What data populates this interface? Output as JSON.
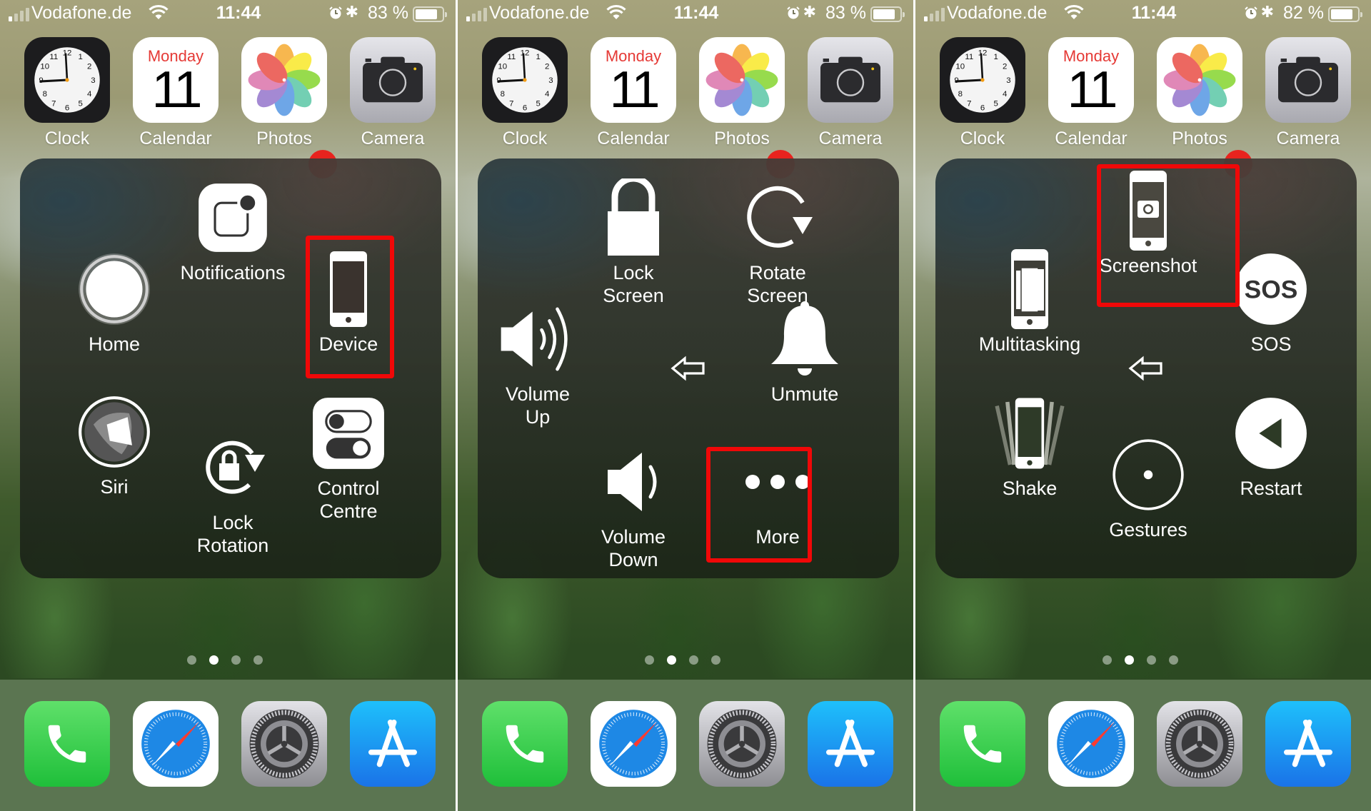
{
  "panels": [
    {
      "status": {
        "carrier": "Vodafone.de",
        "time": "11:44",
        "battery": "83 %",
        "battery_level": 0.83
      },
      "apps": [
        {
          "name": "Clock"
        },
        {
          "name": "Calendar",
          "weekday": "Monday",
          "date": "11"
        },
        {
          "name": "Photos"
        },
        {
          "name": "Camera"
        }
      ],
      "menu": {
        "items": [
          {
            "label": "Notifications",
            "icon": "notification-center-icon"
          },
          {
            "label": "Device",
            "icon": "device-icon",
            "highlighted": true
          },
          {
            "label": "Control\nCentre",
            "icon": "control-centre-icon"
          },
          {
            "label": "Lock\nRotation",
            "icon": "lock-rotation-icon"
          },
          {
            "label": "Siri",
            "icon": "siri-icon"
          },
          {
            "label": "Home",
            "icon": "home-button-icon"
          }
        ]
      },
      "page_dots": {
        "count": 4,
        "active": 2
      }
    },
    {
      "status": {
        "carrier": "Vodafone.de",
        "time": "11:44",
        "battery": "83 %",
        "battery_level": 0.83
      },
      "apps": [
        {
          "name": "Clock"
        },
        {
          "name": "Calendar",
          "weekday": "Monday",
          "date": "11"
        },
        {
          "name": "Photos"
        },
        {
          "name": "Camera"
        }
      ],
      "menu": {
        "items": [
          {
            "label": "Lock\nScreen",
            "icon": "padlock-icon"
          },
          {
            "label": "Rotate\nScreen",
            "icon": "rotate-icon"
          },
          {
            "label": "Unmute",
            "icon": "bell-icon"
          },
          {
            "label": "More",
            "icon": "more-dots-icon",
            "highlighted": true
          },
          {
            "label": "Volume\nDown",
            "icon": "volume-down-icon"
          },
          {
            "label": "Volume\nUp",
            "icon": "volume-up-icon"
          }
        ]
      },
      "page_dots": {
        "count": 4,
        "active": 2
      }
    },
    {
      "status": {
        "carrier": "Vodafone.de",
        "time": "11:44",
        "battery": "82 %",
        "battery_level": 0.82
      },
      "apps": [
        {
          "name": "Clock"
        },
        {
          "name": "Calendar",
          "weekday": "Monday",
          "date": "11"
        },
        {
          "name": "Photos"
        },
        {
          "name": "Camera"
        }
      ],
      "menu": {
        "items": [
          {
            "label": "Screenshot",
            "icon": "screenshot-icon",
            "highlighted": true
          },
          {
            "label": "SOS",
            "icon": "sos-icon",
            "glyph": "SOS"
          },
          {
            "label": "Restart",
            "icon": "restart-icon"
          },
          {
            "label": "Gestures",
            "icon": "gestures-icon"
          },
          {
            "label": "Shake",
            "icon": "shake-icon"
          },
          {
            "label": "Multitasking",
            "icon": "multitasking-icon"
          }
        ]
      },
      "page_dots": {
        "count": 4,
        "active": 2
      }
    }
  ],
  "dock": [
    {
      "name": "Phone"
    },
    {
      "name": "Safari"
    },
    {
      "name": "Settings"
    },
    {
      "name": "App Store"
    }
  ],
  "colors": {
    "highlight": "#f00808",
    "badge": "#e8231e",
    "calendar_red": "#e53935"
  }
}
